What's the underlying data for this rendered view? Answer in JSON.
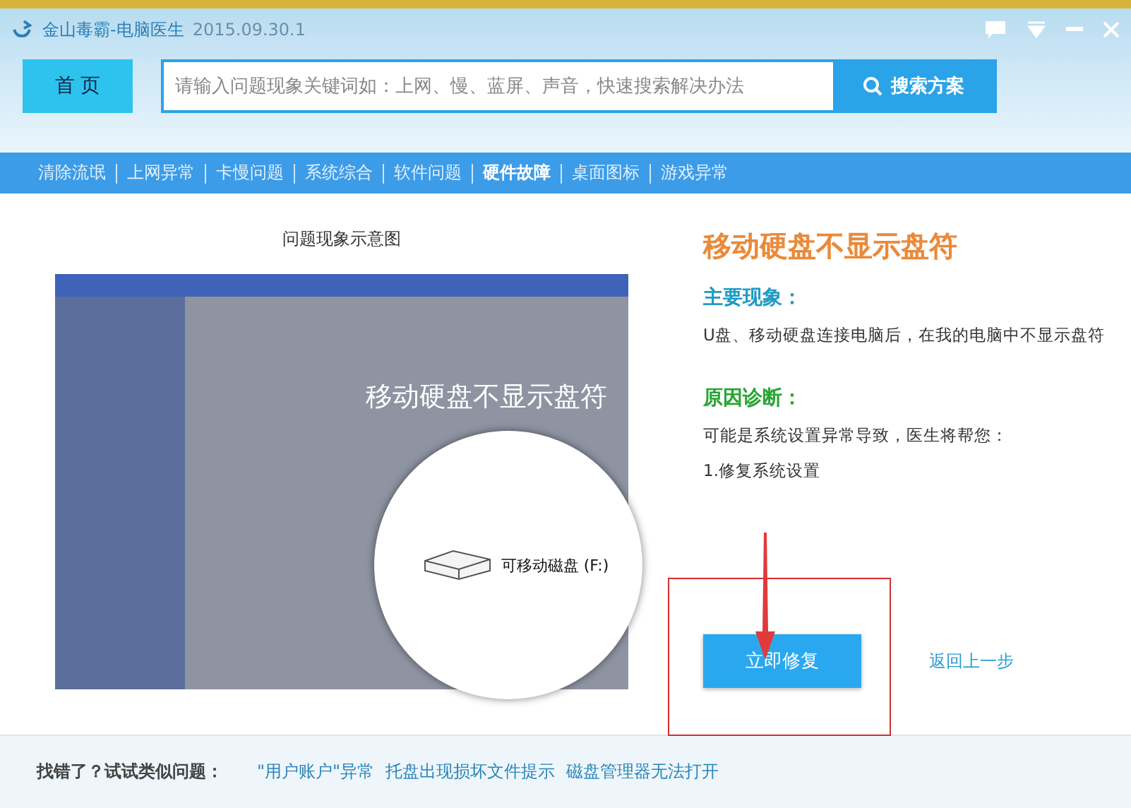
{
  "window": {
    "app_name": "金山毒霸-电脑医生",
    "version": "2015.09.30.1"
  },
  "header": {
    "home_button": "首 页",
    "search": {
      "placeholder": "请输入问题现象关键词如：上网、慢、蓝屏、声音，快速搜索解决办法"
    },
    "search_button": "搜索方案"
  },
  "tabs": [
    {
      "label": "清除流氓",
      "selected": false
    },
    {
      "label": "上网异常",
      "selected": false
    },
    {
      "label": "卡慢问题",
      "selected": false
    },
    {
      "label": "系统综合",
      "selected": false
    },
    {
      "label": "软件问题",
      "selected": false
    },
    {
      "label": "硬件故障",
      "selected": true
    },
    {
      "label": "桌面图标",
      "selected": false
    },
    {
      "label": "游戏异常",
      "selected": false
    }
  ],
  "illustration": {
    "caption": "问题现象示意图",
    "overlay_title": "移动硬盘不显示盘符",
    "drive_label": "可移动磁盘 (F:)"
  },
  "detail": {
    "title": "移动硬盘不显示盘符",
    "sections": [
      {
        "heading": "主要现象：",
        "color": "#1f9bc4",
        "lines": [
          "U盘、移动硬盘连接电脑后，在我的电脑中不显示盘符"
        ]
      },
      {
        "heading": "原因诊断：",
        "color": "#2aa535",
        "lines": [
          "可能是系统设置异常导致，医生将帮您：",
          "1.修复系统设置"
        ]
      }
    ],
    "fix_button": "立即修复",
    "back_link": "返回上一步"
  },
  "footer": {
    "label": "找错了？试试类似问题：",
    "links": [
      "\"用户账户\"异常",
      "托盘出现损坏文件提示",
      "磁盘管理器无法打开"
    ]
  }
}
